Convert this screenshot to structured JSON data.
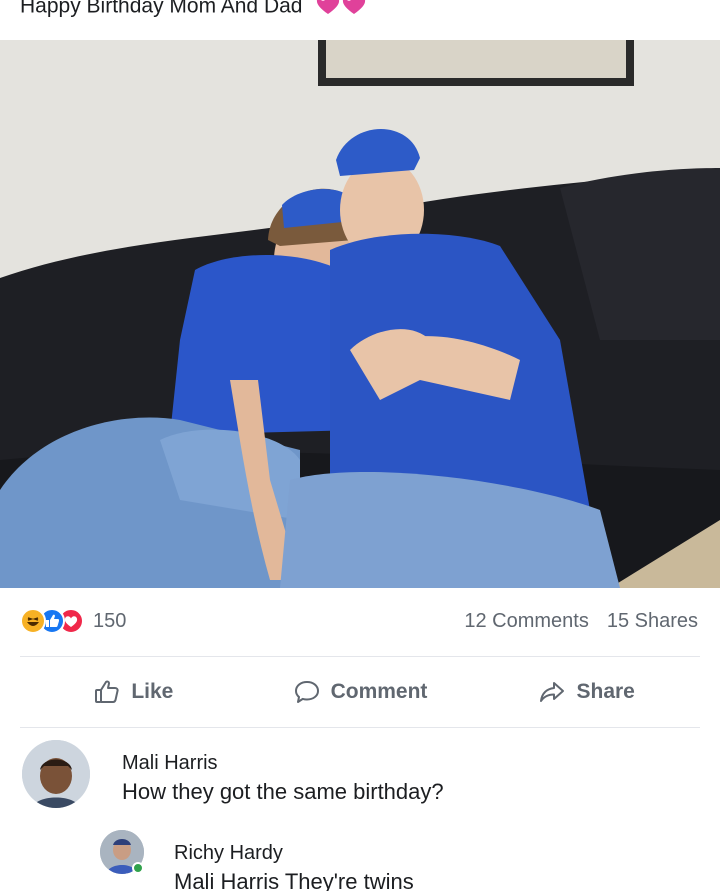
{
  "post": {
    "caption": "Happy Birthday Mom And Dad",
    "caption_emoji": "sparkling-heart-icon"
  },
  "reactions": {
    "types": [
      "haha",
      "like",
      "love"
    ],
    "count": "150",
    "comments": "12 Comments",
    "shares": "15 Shares",
    "colors": {
      "haha": "#f7b125",
      "like": "#1877f2",
      "love": "#f0284a"
    }
  },
  "actions": {
    "like_label": "Like",
    "comment_label": "Comment",
    "share_label": "Share"
  },
  "comments": [
    {
      "name": "Mali Harris",
      "text": "How they got the same birthday?"
    },
    {
      "name": "Richy Hardy",
      "text": "Mali Harris They're twins"
    }
  ],
  "colors": {
    "accent": "#1877f2",
    "online": "#31a24c",
    "muted_text": "#606770"
  }
}
